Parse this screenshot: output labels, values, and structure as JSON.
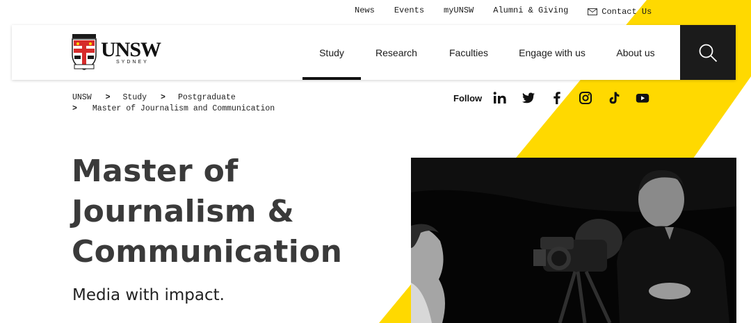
{
  "utility_nav": {
    "news": "News",
    "events": "Events",
    "myunsw": "myUNSW",
    "alumni": "Alumni & Giving",
    "contact": "Contact Us"
  },
  "logo": {
    "name": "UNSW",
    "sub": "SYDNEY"
  },
  "main_nav": {
    "items": [
      {
        "label": "Study",
        "active": true
      },
      {
        "label": "Research"
      },
      {
        "label": "Faculties"
      },
      {
        "label": "Engage with us"
      },
      {
        "label": "About us"
      }
    ]
  },
  "icons": {
    "search": "search-icon",
    "mail": "mail-icon",
    "linkedin": "linkedin-icon",
    "twitter": "twitter-icon",
    "facebook": "facebook-icon",
    "instagram": "instagram-icon",
    "tiktok": "tiktok-icon",
    "youtube": "youtube-icon"
  },
  "breadcrumb": {
    "items": [
      "UNSW",
      "Study",
      "Postgraduate",
      "Master of Journalism and Communication"
    ],
    "separator": ">"
  },
  "follow": {
    "label": "Follow"
  },
  "hero": {
    "title_line1": "Master of",
    "title_line2": "Journalism &",
    "title_line3": "Communication",
    "subtitle": "Media with impact."
  },
  "colors": {
    "accent_yellow": "#ffd900",
    "dark": "#1b1b1b",
    "text": "#3a3a3a"
  }
}
